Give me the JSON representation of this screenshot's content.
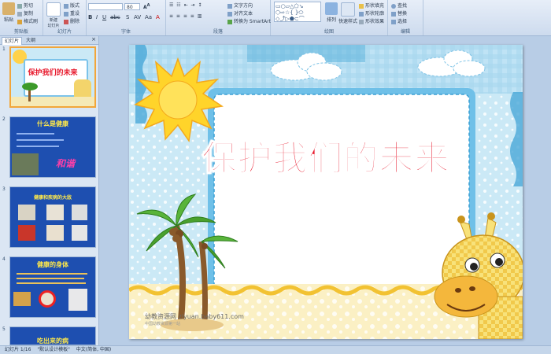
{
  "ribbon": {
    "clipboard": {
      "paste": "粘贴",
      "cut": "剪切",
      "copy": "复制",
      "format_painter": "格式刷",
      "label": "剪贴板"
    },
    "slides": {
      "new_slide": "新建\n幻灯片",
      "layout": "版式",
      "reset": "重设",
      "delete": "删除",
      "label": "幻灯片"
    },
    "font": {
      "font_size": "80",
      "label": "字体"
    },
    "paragraph": {
      "text_direction": "文字方向",
      "align_text": "对齐文本",
      "smartart": "转换为 SmartArt",
      "label": "段落"
    },
    "drawing": {
      "arrange": "排列",
      "quick_styles": "快速样式",
      "shape_fill": "形状填充",
      "shape_outline": "形状轮廓",
      "shape_effects": "形状效果",
      "label": "绘图"
    },
    "editing": {
      "find": "查找",
      "replace": "替换",
      "select": "选择",
      "label": "编辑"
    }
  },
  "panel": {
    "tabs": [
      "幻灯片",
      "大纲"
    ],
    "thumbnails": [
      {
        "num": "1",
        "title": "保护我们的未来"
      },
      {
        "num": "2",
        "title": "什么是健康",
        "extra": "和谐"
      },
      {
        "num": "3",
        "title": "健康和疾病的大敌"
      },
      {
        "num": "4",
        "title": "健康的身体"
      },
      {
        "num": "5",
        "title": "吃出来的病"
      }
    ]
  },
  "slide": {
    "title": "保护我们的未来",
    "watermark_main": "幼教资源网 ziyuan.baby611.com",
    "watermark_sub": "中国幼教资源第一站"
  },
  "status": {
    "slide_count": "幻灯片 1/16",
    "theme": "\"默认设计模板\"",
    "language": "中文(简体, 中国)"
  },
  "colors": {
    "title_fill": "#e8192c",
    "accent": "#f2a63a",
    "slide_bg": "#cbe9f6"
  }
}
